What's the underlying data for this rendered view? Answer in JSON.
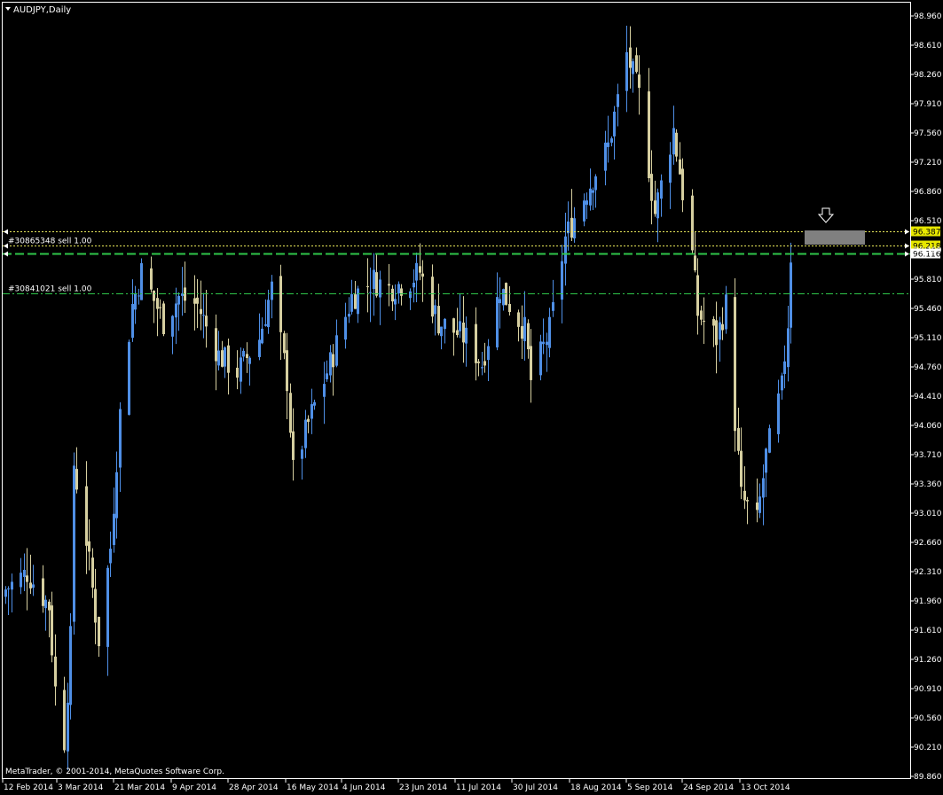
{
  "window": {
    "title": "AUDJPY,Daily",
    "copyright": "MetaTrader, © 2001-2014, MetaQuotes Software Corp."
  },
  "colors": {
    "background": "#000000",
    "frame": "#ffffff",
    "bull_candle": "#4f8fe6",
    "bear_candle": "#d6cfa0",
    "order_line": "#2fc64a",
    "bid_line": "#2fc64a",
    "dotted_level": "#e8e85a",
    "current_price_bg": "#e8e800",
    "shaded_box": "#808080"
  },
  "orders": [
    {
      "label": "#30865348 sell 1.00",
      "price": 96.218,
      "style": "dotted"
    },
    {
      "label": "#30841021 sell 1.00",
      "price": 95.64,
      "style": "dashdot"
    }
  ],
  "levels": [
    {
      "price": 96.387,
      "label": "96.387",
      "style": "dotted",
      "highlight": true
    },
    {
      "price": 96.218,
      "label": "96.218",
      "style": "dotted",
      "highlight": true
    },
    {
      "price": 96.116,
      "label": "96.116",
      "style": "dashed-bid",
      "highlight": false
    }
  ],
  "chart_data": {
    "type": "candlestick",
    "symbol": "AUDJPY",
    "timeframe": "Daily",
    "ylim": [
      89.86,
      98.96
    ],
    "y_ticks": [
      "98.960",
      "98.610",
      "98.260",
      "97.910",
      "97.560",
      "97.210",
      "96.860",
      "96.510",
      "96.160",
      "95.810",
      "95.460",
      "95.110",
      "94.760",
      "94.410",
      "94.060",
      "93.710",
      "93.360",
      "93.010",
      "92.660",
      "92.310",
      "91.960",
      "91.610",
      "91.260",
      "90.910",
      "90.560",
      "90.210",
      "89.860"
    ],
    "x_ticks": [
      "12 Feb 2014",
      "3 Mar 2014",
      "21 Mar 2014",
      "9 Apr 2014",
      "28 Apr 2014",
      "16 May 2014",
      "4 Jun 2014",
      "23 Jun 2014",
      "11 Jul 2014",
      "30 Jul 2014",
      "18 Aug 2014",
      "5 Sep 2014",
      "24 Sep 2014",
      "13 Oct 2014"
    ],
    "close_path": [
      {
        "date": "12 Feb 2014",
        "close": 92.1
      },
      {
        "date": "19 Feb 2014",
        "close": 92.3
      },
      {
        "date": "26 Feb 2014",
        "close": 91.9
      },
      {
        "date": "28 Feb 2014",
        "close": 90.9
      },
      {
        "date": "3 Mar 2014",
        "close": 90.3
      },
      {
        "date": "5 Mar 2014",
        "close": 91.5
      },
      {
        "date": "6 Mar 2014",
        "close": 93.6
      },
      {
        "date": "10 Mar 2014",
        "close": 92.7
      },
      {
        "date": "14 Mar 2014",
        "close": 91.5
      },
      {
        "date": "18 Mar 2014",
        "close": 92.6
      },
      {
        "date": "21 Mar 2014",
        "close": 94.2
      },
      {
        "date": "25 Mar 2014",
        "close": 95.5
      },
      {
        "date": "28 Mar 2014",
        "close": 95.9
      },
      {
        "date": "4 Apr 2014",
        "close": 95.3
      },
      {
        "date": "9 Apr 2014",
        "close": 95.6
      },
      {
        "date": "15 Apr 2014",
        "close": 95.5
      },
      {
        "date": "22 Apr 2014",
        "close": 94.9
      },
      {
        "date": "28 Apr 2014",
        "close": 94.7
      },
      {
        "date": "5 May 2014",
        "close": 95.1
      },
      {
        "date": "9 May 2014",
        "close": 95.7
      },
      {
        "date": "14 May 2014",
        "close": 94.6
      },
      {
        "date": "16 May 2014",
        "close": 93.5
      },
      {
        "date": "22 May 2014",
        "close": 94.2
      },
      {
        "date": "28 May 2014",
        "close": 94.8
      },
      {
        "date": "4 Jun 2014",
        "close": 95.6
      },
      {
        "date": "11 Jun 2014",
        "close": 95.8
      },
      {
        "date": "16 Jun 2014",
        "close": 95.7
      },
      {
        "date": "23 Jun 2014",
        "close": 95.8
      },
      {
        "date": "26 Jun 2014",
        "close": 95.9
      },
      {
        "date": "2 Jul 2014",
        "close": 95.3
      },
      {
        "date": "11 Jul 2014",
        "close": 95.1
      },
      {
        "date": "16 Jul 2014",
        "close": 94.8
      },
      {
        "date": "22 Jul 2014",
        "close": 95.7
      },
      {
        "date": "30 Jul 2014",
        "close": 95.2
      },
      {
        "date": "1 Aug 2014",
        "close": 94.6
      },
      {
        "date": "7 Aug 2014",
        "close": 95.2
      },
      {
        "date": "12 Aug 2014",
        "close": 96.3
      },
      {
        "date": "18 Aug 2014",
        "close": 96.8
      },
      {
        "date": "26 Aug 2014",
        "close": 97.4
      },
      {
        "date": "1 Sep 2014",
        "close": 98.5
      },
      {
        "date": "5 Sep 2014",
        "close": 98.0
      },
      {
        "date": "10 Sep 2014",
        "close": 96.6
      },
      {
        "date": "16 Sep 2014",
        "close": 97.6
      },
      {
        "date": "22 Sep 2014",
        "close": 96.1
      },
      {
        "date": "24 Sep 2014",
        "close": 95.4
      },
      {
        "date": "30 Sep 2014",
        "close": 95.1
      },
      {
        "date": "3 Oct 2014",
        "close": 95.5
      },
      {
        "date": "8 Oct 2014",
        "close": 93.2
      },
      {
        "date": "13 Oct 2014",
        "close": 92.9
      },
      {
        "date": "16 Oct 2014",
        "close": 93.7
      },
      {
        "date": "21 Oct 2014",
        "close": 94.5
      },
      {
        "date": "23 Oct 2014",
        "close": 95.3
      },
      {
        "date": "24 Oct 2014",
        "close": 96.1
      }
    ],
    "grid": false
  }
}
